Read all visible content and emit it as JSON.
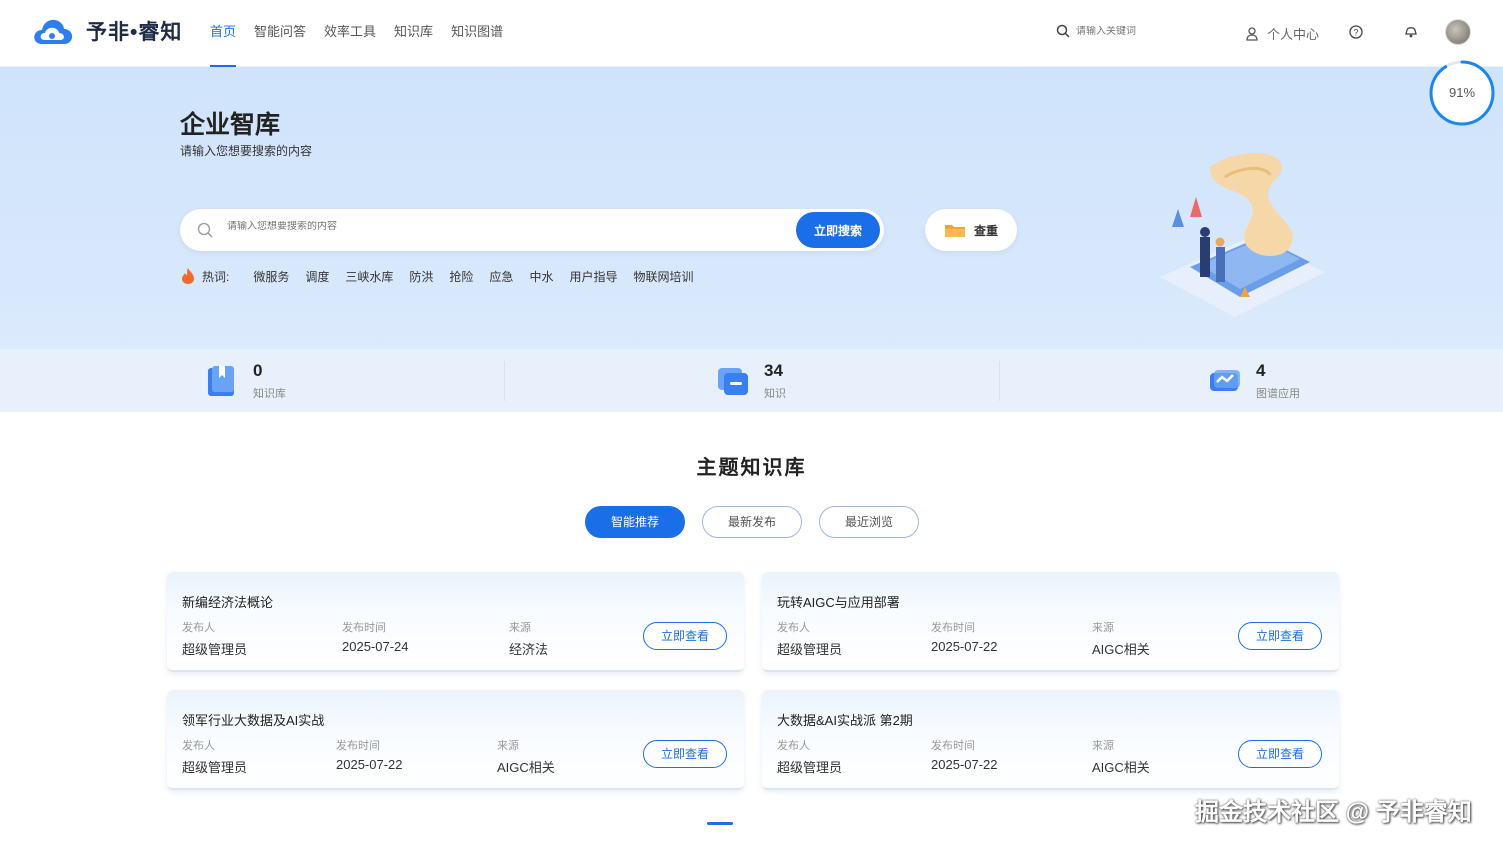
{
  "app": {
    "name": "予非•睿知"
  },
  "nav": {
    "items": [
      {
        "label": "首页",
        "active": true
      },
      {
        "label": "智能问答",
        "active": false
      },
      {
        "label": "效率工具",
        "active": false
      },
      {
        "label": "知识库",
        "active": false
      },
      {
        "label": "知识图谱",
        "active": false
      }
    ]
  },
  "top_search": {
    "placeholder": "请输入关键词",
    "icon": "search-icon"
  },
  "user": {
    "personal_center": "个人中心",
    "icons": [
      "user-icon",
      "help-icon",
      "notification-icon",
      "avatar"
    ]
  },
  "progress": {
    "label": "91%",
    "value": 0.91
  },
  "hero": {
    "title": "企业智库",
    "subtitle": "请输入您想要搜索的内容",
    "search_placeholder": "请输入您想要搜索的内容",
    "search_button": "立即搜索",
    "dedupe_button": "查重",
    "hot_label": "热词:",
    "hot_words": [
      "微服务",
      "调度",
      "三峡水库",
      "防洪",
      "抢险",
      "应急",
      "中水",
      "用户指导",
      "物联网培训"
    ]
  },
  "stats": [
    {
      "value": "0",
      "label": "知识库",
      "icon": "knowledge-base-icon"
    },
    {
      "value": "34",
      "label": "知识",
      "icon": "knowledge-icon"
    },
    {
      "value": "4",
      "label": "图谱应用",
      "icon": "graph-app-icon"
    }
  ],
  "section": {
    "title": "主题知识库",
    "tabs": [
      {
        "label": "智能推荐",
        "active": true
      },
      {
        "label": "最新发布",
        "active": false
      },
      {
        "label": "最近浏览",
        "active": false
      }
    ]
  },
  "cards": [
    {
      "title": "新编经济法概论",
      "publisher_label": "发布人",
      "publisher": "超级管理员",
      "time_label": "发布时间",
      "time": "2025-07-24",
      "source_label": "来源",
      "source": "经济法",
      "button": "立即查看"
    },
    {
      "title": "玩转AIGC与应用部署",
      "publisher_label": "发布人",
      "publisher": "超级管理员",
      "time_label": "发布时间",
      "time": "2025-07-22",
      "source_label": "来源",
      "source": "AIGC相关",
      "button": "立即查看"
    },
    {
      "title": "领军行业大数据及AI实战",
      "publisher_label": "发布人",
      "publisher": "超级管理员",
      "time_label": "发布时间",
      "time": "2025-07-22",
      "source_label": "来源",
      "source": "AIGC相关",
      "button": "立即查看"
    },
    {
      "title": "大数据&AI实战派 第2期",
      "publisher_label": "发布人",
      "publisher": "超级管理员",
      "time_label": "发布时间",
      "time": "2025-07-22",
      "source_label": "来源",
      "source": "AIGC相关",
      "button": "立即查看"
    }
  ],
  "watermark": "掘金技术社区 @ 予非睿知",
  "colors": {
    "accent": "#1a6fe8",
    "hero_bg": "#d6e8fb",
    "stats_bg": "#e8f1fb"
  }
}
